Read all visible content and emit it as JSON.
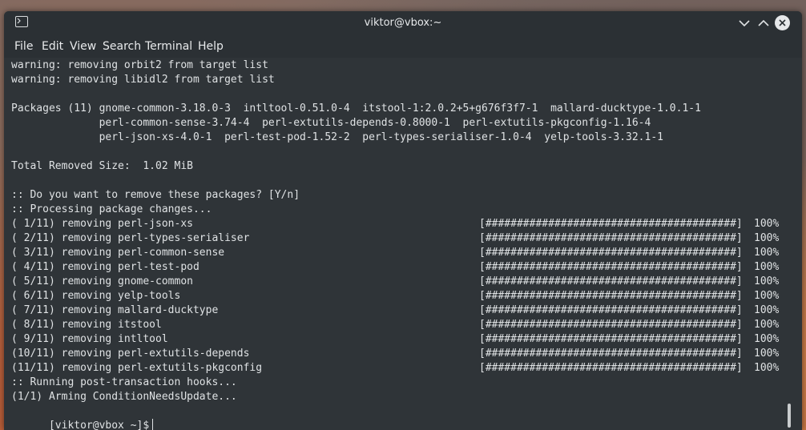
{
  "window": {
    "title": "viktor@vbox:~"
  },
  "menu": [
    "File",
    "Edit",
    "View",
    "Search",
    "Terminal",
    "Help"
  ],
  "lines": [
    "warning: removing orbit2 from target list",
    "warning: removing libidl2 from target list",
    "",
    "Packages (11) gnome-common-3.18.0-3  intltool-0.51.0-4  itstool-1:2.0.2+5+g676f3f7-1  mallard-ducktype-1.0.1-1",
    "              perl-common-sense-3.74-4  perl-extutils-depends-0.8000-1  perl-extutils-pkgconfig-1.16-4",
    "              perl-json-xs-4.0-1  perl-test-pod-1.52-2  perl-types-serialiser-1.0-4  yelp-tools-3.32.1-1",
    "",
    "Total Removed Size:  1.02 MiB",
    "",
    ":: Do you want to remove these packages? [Y/n]",
    ":: Processing package changes..."
  ],
  "progress": [
    {
      "label": "( 1/11) removing perl-json-xs",
      "bar": "[########################################]",
      "pct": "100%",
      "fraction": 1.0
    },
    {
      "label": "( 2/11) removing perl-types-serialiser",
      "bar": "[########################################]",
      "pct": "100%",
      "fraction": 1.0
    },
    {
      "label": "( 3/11) removing perl-common-sense",
      "bar": "[########################################]",
      "pct": "100%",
      "fraction": 1.0
    },
    {
      "label": "( 4/11) removing perl-test-pod",
      "bar": "[########################################]",
      "pct": "100%",
      "fraction": 1.0
    },
    {
      "label": "( 5/11) removing gnome-common",
      "bar": "[########################################]",
      "pct": "100%",
      "fraction": 1.0
    },
    {
      "label": "( 6/11) removing yelp-tools",
      "bar": "[########################################]",
      "pct": "100%",
      "fraction": 1.0
    },
    {
      "label": "( 7/11) removing mallard-ducktype",
      "bar": "[########################################]",
      "pct": "100%",
      "fraction": 1.0
    },
    {
      "label": "( 8/11) removing itstool",
      "bar": "[########################################]",
      "pct": "100%",
      "fraction": 1.0
    },
    {
      "label": "( 9/11) removing intltool",
      "bar": "[########################################]",
      "pct": "100%",
      "fraction": 1.0
    },
    {
      "label": "(10/11) removing perl-extutils-depends",
      "bar": "[########################################]",
      "pct": "100%",
      "fraction": 1.0
    },
    {
      "label": "(11/11) removing perl-extutils-pkgconfig",
      "bar": "[########################################]",
      "pct": "100%",
      "fraction": 1.0
    }
  ],
  "post_lines": [
    ":: Running post-transaction hooks...",
    "(1/1) Arming ConditionNeedsUpdate..."
  ],
  "prompt": "[viktor@vbox ~]$",
  "colors": {
    "terminal_bg": "#2f3438",
    "titlebar_bg": "#2b3034",
    "text": "#dfe2e4"
  },
  "icons": {
    "app": "terminal-icon",
    "minimize": "chevron-down-icon",
    "maximize": "chevron-up-icon",
    "close": "close-icon"
  }
}
